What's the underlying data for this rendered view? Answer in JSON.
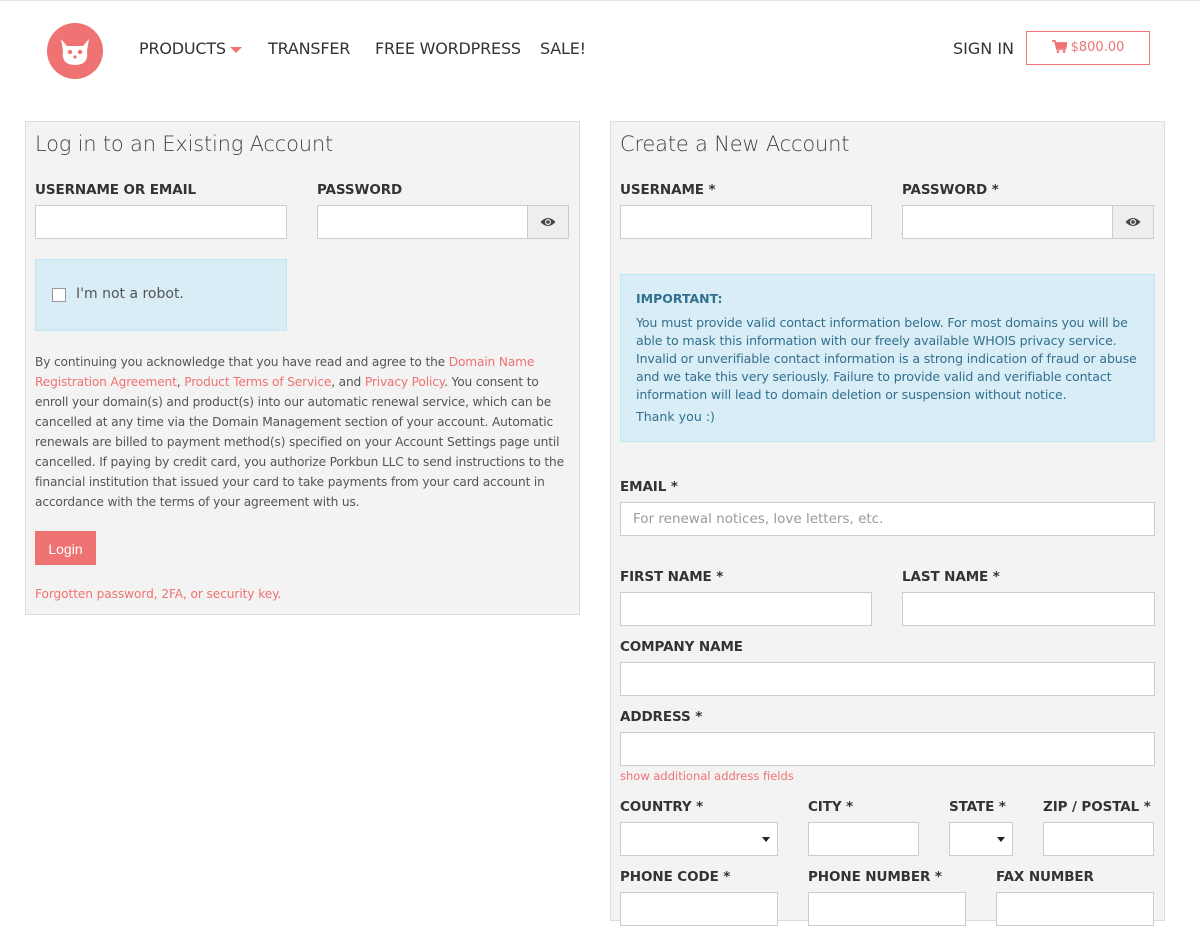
{
  "header": {
    "nav": {
      "products": "PRODUCTS",
      "transfer": "TRANSFER",
      "free_wordpress": "FREE WORDPRESS",
      "sale": "SALE!"
    },
    "sign_in": "SIGN IN",
    "cart_total": "$800.00"
  },
  "login": {
    "title": "Log in to an Existing Account",
    "username_label": "USERNAME OR EMAIL",
    "username_value": "",
    "password_label": "PASSWORD",
    "password_value": "",
    "captcha_label": "I'm not a robot.",
    "legal": {
      "p1": "By continuing you acknowledge that you have read and agree to the ",
      "link1": "Domain Name Registration Agreement",
      "sep1": ", ",
      "link2": "Product Terms of Service",
      "sep2": ", and ",
      "link3": "Privacy Policy",
      "p2": ". You consent to enroll your domain(s) and product(s) into our automatic renewal service, which can be cancelled at any time via the Domain Management section of your account. Automatic renewals are billed to payment method(s) specified on your Account Settings page until cancelled. If paying by credit card, you authorize Porkbun LLC to send instructions to the financial institution that issued your card to take payments from your card account in accordance with the terms of your agreement with us."
    },
    "login_button": "Login",
    "forgot_link": "Forgotten password, 2FA, or security key."
  },
  "create": {
    "title": "Create a New Account",
    "username_label": "USERNAME *",
    "password_label": "PASSWORD *",
    "important": {
      "title": "IMPORTANT:",
      "body": "You must provide valid contact information below. For most domains you will be able to mask this information with our freely available WHOIS privacy service. Invalid or unverifiable contact information is a strong indication of fraud or abuse and we take this very seriously. Failure to provide valid and verifiable contact information will lead to domain deletion or suspension without notice.",
      "thanks": "Thank you :)"
    },
    "email_label": "EMAIL *",
    "email_placeholder": "For renewal notices, love letters, etc.",
    "first_name_label": "FIRST NAME *",
    "last_name_label": "LAST NAME *",
    "company_label": "COMPANY NAME",
    "address_label": "ADDRESS *",
    "additional_address_link": "show additional address fields",
    "country_label": "COUNTRY *",
    "city_label": "CITY *",
    "state_label": "STATE *",
    "zip_label": "ZIP / POSTAL *",
    "phone_code_label": "PHONE CODE *",
    "phone_number_label": "PHONE NUMBER *",
    "fax_label": "FAX NUMBER"
  },
  "colors": {
    "accent": "#ef7373",
    "panel_bg": "#f3f3f3",
    "info_bg": "#d9edf7",
    "info_text": "#31708f"
  },
  "icons": [
    "porkbun-logo-icon",
    "chevron-down-icon",
    "cart-icon",
    "eye-icon",
    "checkbox-icon"
  ]
}
